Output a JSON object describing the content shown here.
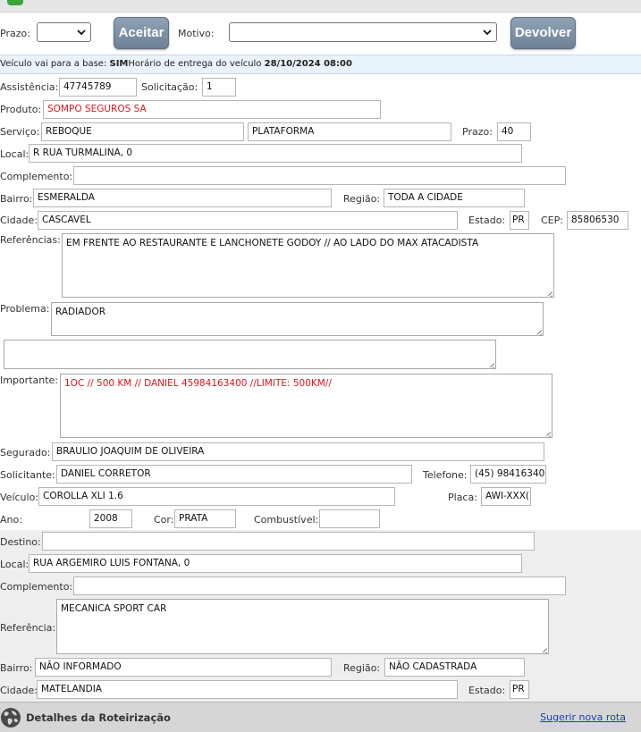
{
  "toolbar": {
    "prazo_label": "Prazo:",
    "prazo_value": "",
    "aceitar_label": "Aceitar",
    "motivo_label": "Motivo:",
    "motivo_value": "",
    "devolver_label": "Devolver"
  },
  "info": {
    "base_text": "Veículo vai para a base: ",
    "base_value": "SIM",
    "horario_text": "Horário de entrega do veículo ",
    "horario_value": "28/10/2024 08:00"
  },
  "origem": {
    "assistencia_label": "Assistência:",
    "assistencia_value": "47745789",
    "solicitacao_label": "Solicitação:",
    "solicitacao_value": "1",
    "produto_label": "Produto:",
    "produto_value": "SOMPO SEGUROS SA",
    "servico_label": "Serviço:",
    "servico_value": "REBOQUE",
    "servico_tipo_value": "PLATAFORMA",
    "prazo_label": "Prazo:",
    "prazo_value": "40",
    "local_label": "Local:",
    "local_value": "R RUA TURMALINA, 0",
    "complemento_label": "Complemento:",
    "complemento_value": "",
    "bairro_label": "Bairro:",
    "bairro_value": "ESMERALDA",
    "regiao_label": "Região:",
    "regiao_value": "TODA A CIDADE",
    "cidade_label": "Cidade:",
    "cidade_value": "CASCAVEL",
    "estado_label": "Estado:",
    "estado_value": "PR",
    "cep_label": "CEP:",
    "cep_value": "85806530",
    "referencias_label": "Referências:",
    "referencias_value": "EM FRENTE AO RESTAURANTE E LANCHONETE GODOY // AO LADO DO MAX ATACADISTA",
    "problema_label": "Problema:",
    "problema_value": "RADIADOR",
    "extra_value": "",
    "importante_label": "Importante:",
    "importante_value": "1OC // 500 KM // DANIEL 45984163400  //LIMITE: 500KM//",
    "segurado_label": "Segurado:",
    "segurado_value": "BRAULIO JOAQUIM DE OLIVEIRA",
    "solicitante_label": "Solicitante:",
    "solicitante_value": "DANIEL CORRETOR",
    "telefone_label": "Telefone:",
    "telefone_value": "(45) 98416340(",
    "veiculo_label": "Veículo:",
    "veiculo_value": "COROLLA XLI 1.6",
    "placa_label": "Placa:",
    "placa_value": "AWI-XXX(",
    "ano_label": "Ano:",
    "ano_value": "2008",
    "cor_label": "Cor:",
    "cor_value": "PRATA",
    "combustivel_label": "Combustível:",
    "combustivel_value": ""
  },
  "destino": {
    "destino_label": "Destino:",
    "destino_value": "",
    "local_label": "Local:",
    "local_value": "RUA ARGEMIRO LUIS FONTANA, 0",
    "complemento_label": "Complemento:",
    "complemento_value": "",
    "referencia_label": "Referência:",
    "referencia_value": "MECANICA SPORT CAR",
    "bairro_label": "Bairro:",
    "bairro_value": "NÃO INFORMADO",
    "regiao_label": "Região:",
    "regiao_value": "NÃO CADASTRADA",
    "cidade_label": "Cidade:",
    "cidade_value": "MATELANDIA",
    "estado_label": "Estado:",
    "estado_value": "PR"
  },
  "footer": {
    "title": "Detalhes da Roteirização",
    "link": "Sugerir nova rota"
  },
  "icons": {
    "chevron": "chevron-down-icon",
    "globe": "globe-icon",
    "resize": "resize-grip-icon"
  },
  "colors": {
    "button": "#7a8da2",
    "required_text": "#e0141e",
    "info_bar": "#eaf2fb",
    "link": "#1a3fb5"
  }
}
